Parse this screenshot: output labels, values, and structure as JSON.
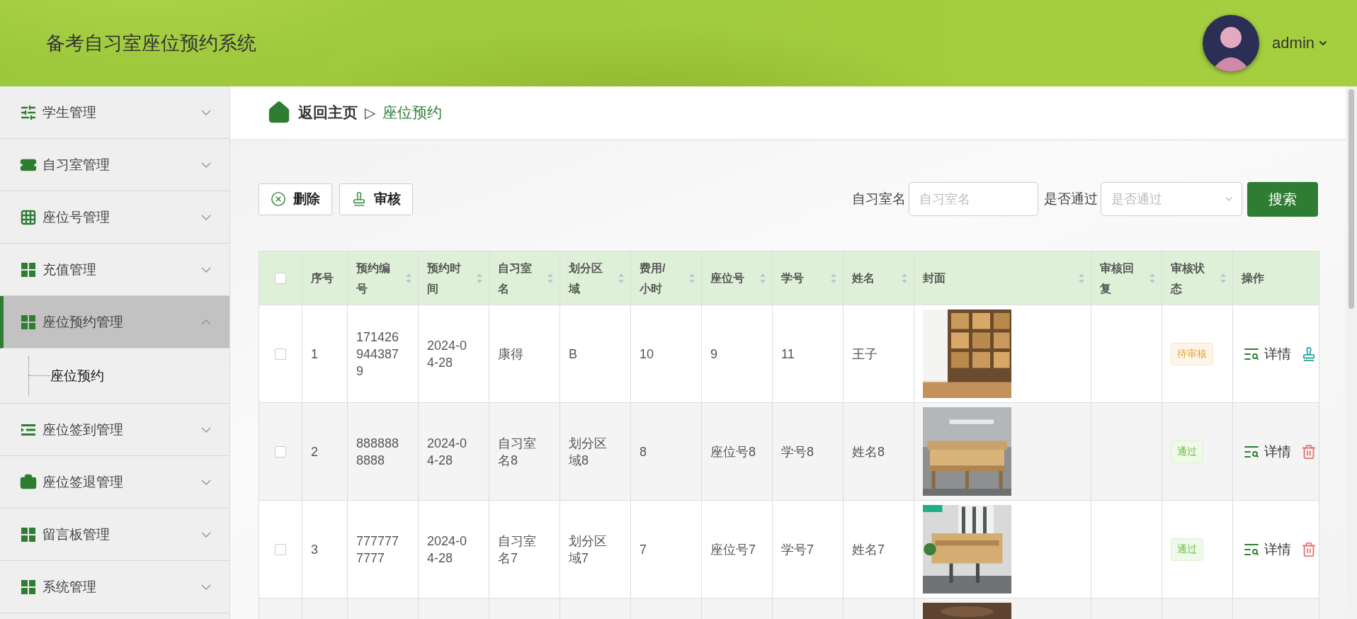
{
  "header": {
    "title": "备考自习室座位预约系统",
    "user": {
      "name": "admin"
    }
  },
  "sidebar": {
    "items": [
      {
        "label": "学生管理",
        "expanded": false,
        "selected": false
      },
      {
        "label": "自习室管理",
        "expanded": false,
        "selected": false
      },
      {
        "label": "座位号管理",
        "expanded": false,
        "selected": false
      },
      {
        "label": "充值管理",
        "expanded": false,
        "selected": false
      },
      {
        "label": "座位预约管理",
        "expanded": true,
        "selected": true,
        "children": [
          {
            "label": "座位预约"
          }
        ]
      },
      {
        "label": "座位签到管理",
        "expanded": false,
        "selected": false
      },
      {
        "label": "座位签退管理",
        "expanded": false,
        "selected": false
      },
      {
        "label": "留言板管理",
        "expanded": false,
        "selected": false
      },
      {
        "label": "系统管理",
        "expanded": false,
        "selected": false
      }
    ]
  },
  "breadcrumb": {
    "home": "返回主页",
    "separator": "▷",
    "current": "座位预约"
  },
  "toolbar": {
    "buttons": [
      {
        "kind": "delete",
        "label": "删除"
      },
      {
        "kind": "audit",
        "label": "审核"
      }
    ],
    "filters": [
      {
        "kind": "input",
        "label": "自习室名",
        "placeholder": "自习室名"
      },
      {
        "kind": "select",
        "label": "是否通过",
        "placeholder": "是否通过"
      }
    ],
    "search_button": "搜索"
  },
  "table": {
    "select_all": {
      "checked": false
    },
    "columns": [
      {
        "label": "序号",
        "sortable": false,
        "kind": "text"
      },
      {
        "label": "预约编号",
        "sortable": true,
        "kind": "text"
      },
      {
        "label": "预约时间",
        "sortable": true,
        "kind": "text"
      },
      {
        "label": "自习室名",
        "sortable": true,
        "kind": "text"
      },
      {
        "label": "划分区域",
        "sortable": true,
        "kind": "text"
      },
      {
        "label": "费用/小时",
        "sortable": true,
        "kind": "text"
      },
      {
        "label": "座位号",
        "sortable": true,
        "kind": "text"
      },
      {
        "label": "学号",
        "sortable": true,
        "kind": "text"
      },
      {
        "label": "姓名",
        "sortable": true,
        "kind": "text"
      },
      {
        "label": "封面",
        "sortable": true,
        "kind": "picture"
      },
      {
        "label": "审核回复",
        "sortable": true,
        "kind": "reply"
      },
      {
        "label": "审核状态",
        "sortable": true,
        "kind": "status"
      },
      {
        "label": "操作",
        "sortable": false,
        "kind": "actions"
      }
    ],
    "rows": [
      {
        "checked": false,
        "cells": [
          "1",
          "1714269443879",
          "2024-04-28",
          "康得",
          "B",
          "10",
          "9",
          "11",
          "王子"
        ],
        "cover": {
          "kind": "picture"
        },
        "status": {
          "label": "待审核",
          "kind": "pending"
        },
        "actions": [
          {
            "kind": "detail",
            "label": "详情"
          },
          {
            "kind": "audit"
          }
        ]
      },
      {
        "checked": false,
        "cells": [
          "2",
          "8888888888",
          "2024-04-28",
          "自习室名8",
          "划分区域8",
          "8",
          "座位号8",
          "学号8",
          "姓名8"
        ],
        "cover": {
          "kind": "picture"
        },
        "status": {
          "label": "通过",
          "kind": "passed"
        },
        "actions": [
          {
            "kind": "detail",
            "label": "详情"
          },
          {
            "kind": "delete"
          }
        ]
      },
      {
        "checked": false,
        "cells": [
          "3",
          "7777777777",
          "2024-04-28",
          "自习室名7",
          "划分区域7",
          "7",
          "座位号7",
          "学号7",
          "姓名7"
        ],
        "cover": {
          "kind": "picture"
        },
        "status": {
          "label": "通过",
          "kind": "passed"
        },
        "actions": [
          {
            "kind": "detail",
            "label": "详情"
          },
          {
            "kind": "delete"
          }
        ]
      },
      {
        "cover": {
          "kind": "picture"
        }
      }
    ]
  }
}
